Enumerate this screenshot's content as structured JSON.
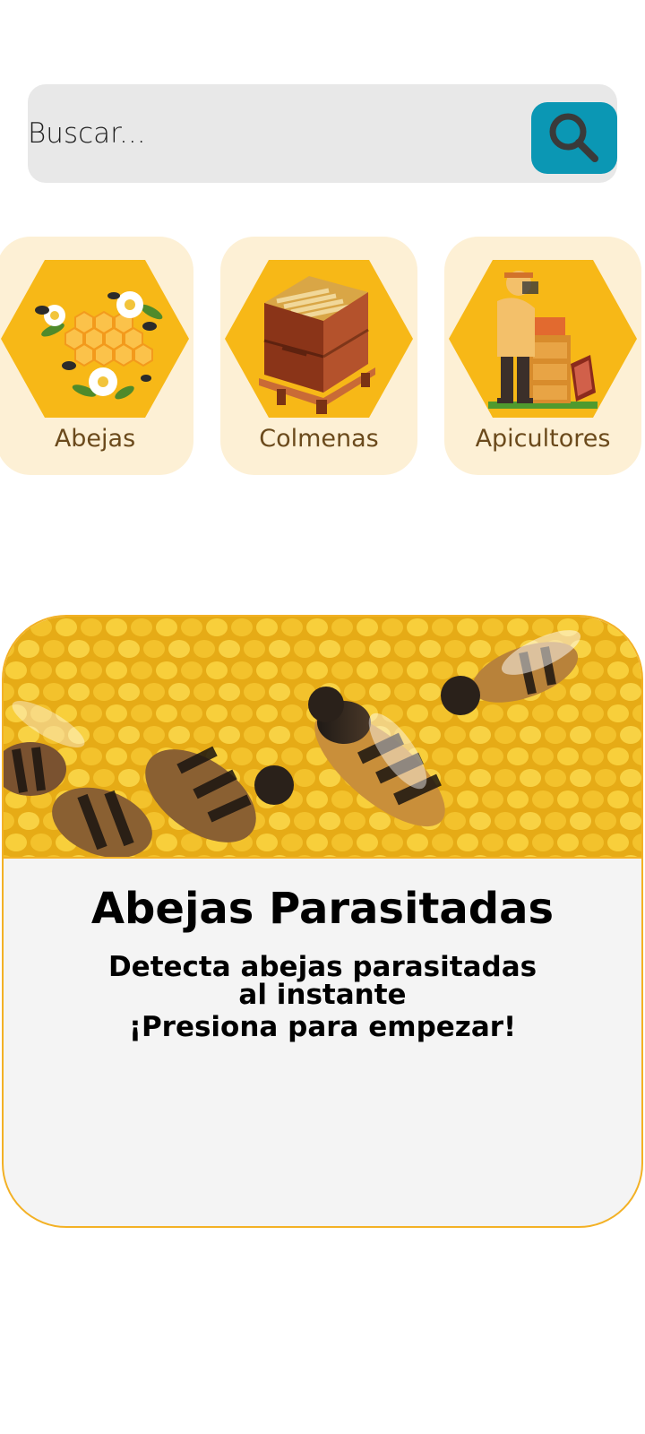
{
  "search": {
    "placeholder": "Buscar...",
    "button_icon": "search-icon",
    "button_color": "#0b97b4"
  },
  "categories": [
    {
      "label": "Abejas",
      "icon": "honeycomb-bees-icon"
    },
    {
      "label": "Colmenas",
      "icon": "beehive-box-icon"
    },
    {
      "label": "Apicultores",
      "icon": "beekeeper-icon"
    }
  ],
  "feature": {
    "image": "bees-on-honeycomb-photo",
    "title": "Abejas Parasitadas",
    "subtitle_line1": "Detecta abejas parasitadas",
    "subtitle_line2": "al instante",
    "cta": "¡Presiona para empezar!"
  },
  "colors": {
    "card_background": "#fdf0d5",
    "hexagon": "#f7b817",
    "label_text": "#6b4a1c",
    "feature_border": "#f3b125"
  }
}
